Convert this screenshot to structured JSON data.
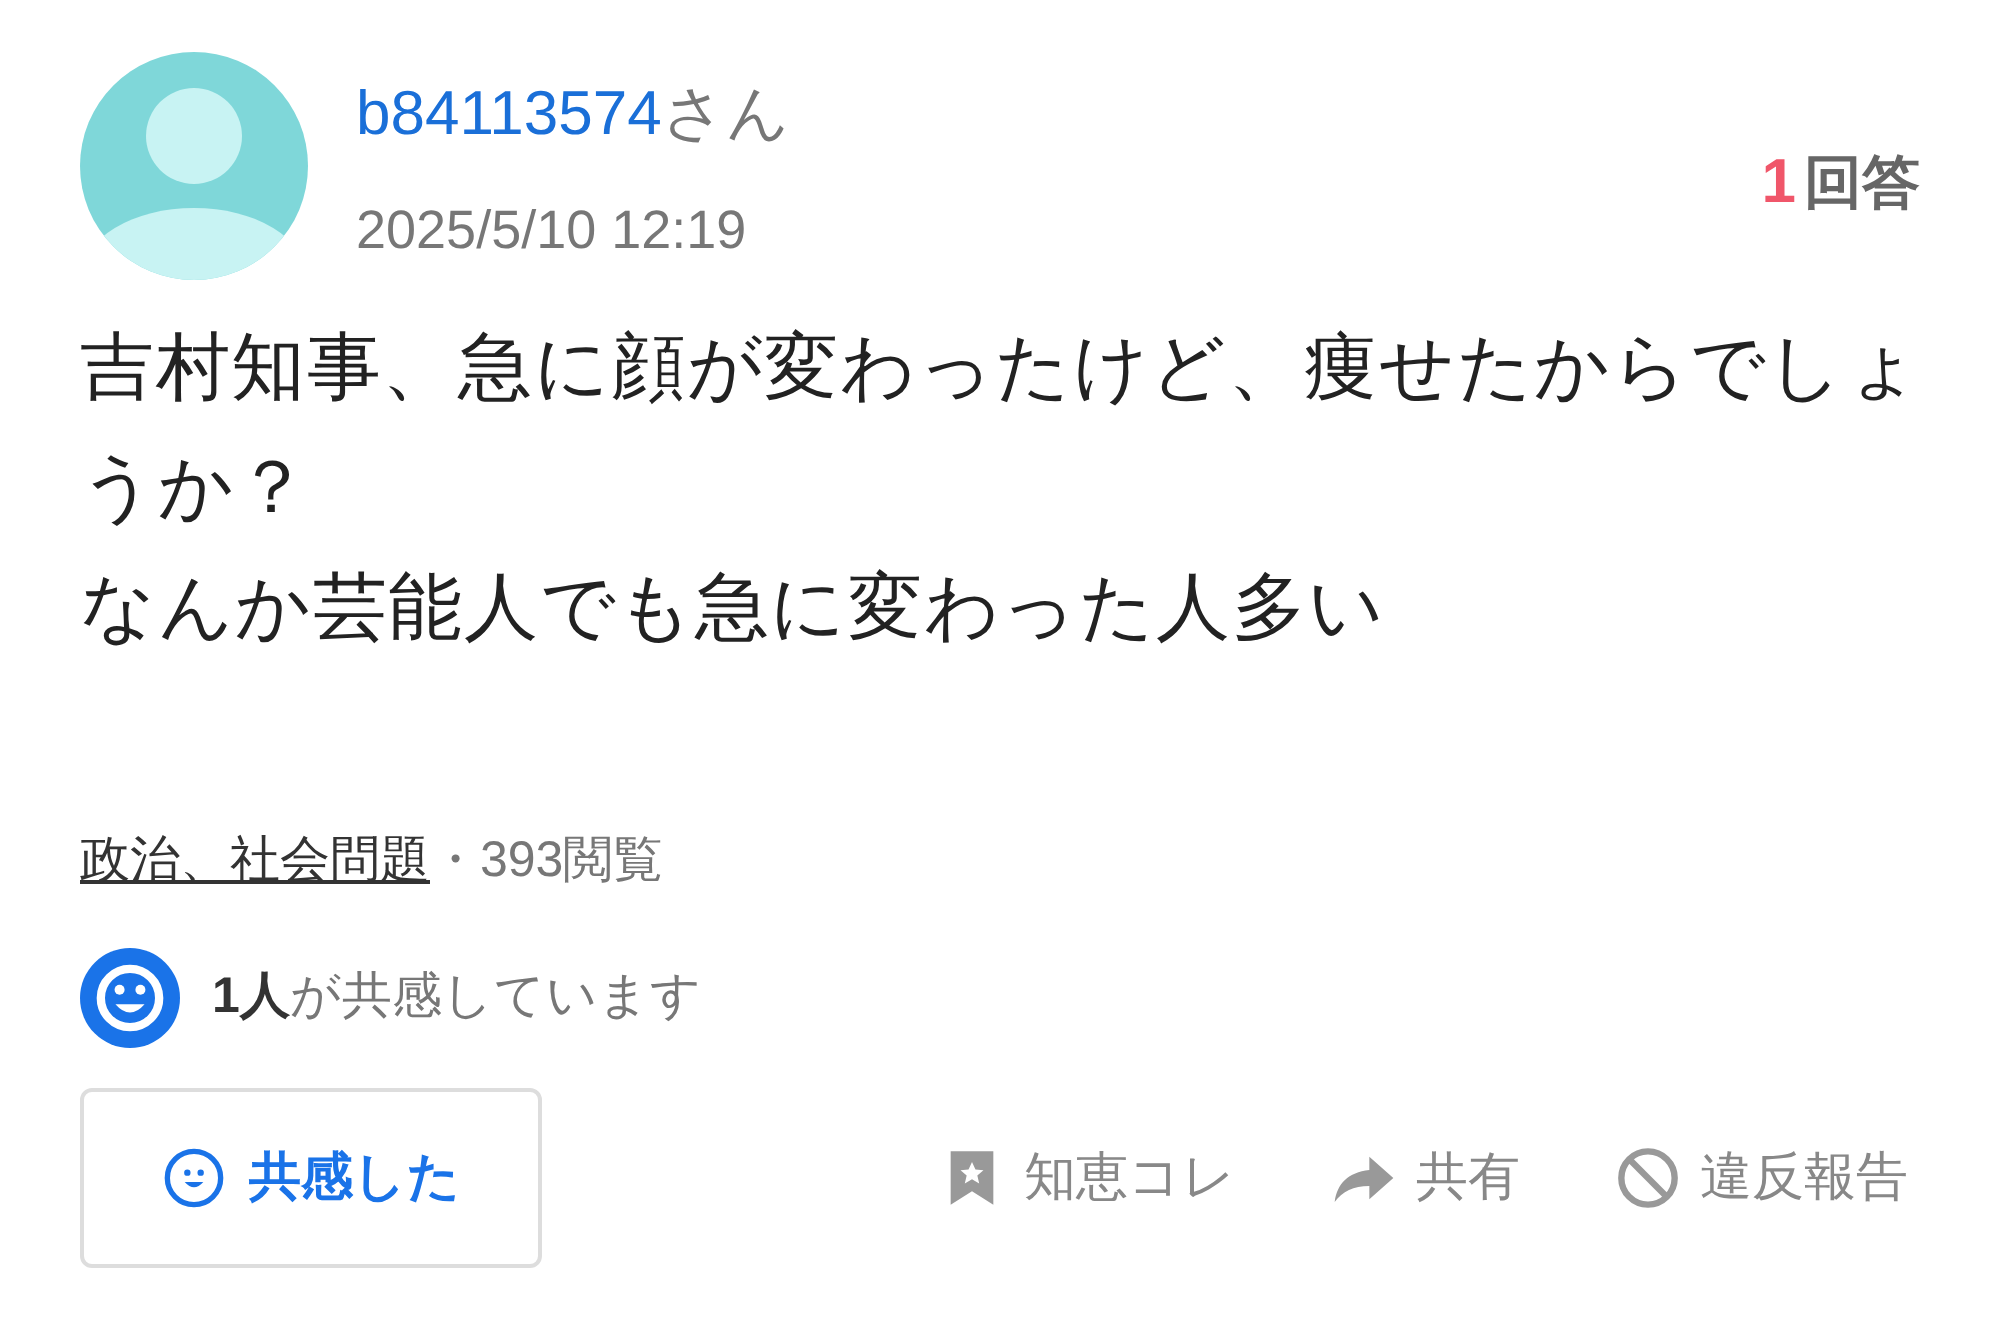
{
  "user": {
    "name": "b84113574",
    "suffix": "さん",
    "date": "2025/5/10 12:19"
  },
  "answers": {
    "count": "1",
    "label": "回答"
  },
  "question": [
    "吉村知事、急に顔が変わったけど、痩せたからでしょうか？",
    "なんか芸能人でも急に変わった人多い"
  ],
  "meta": {
    "category": "政治、社会問題",
    "separator": "・",
    "views": "393閲覧"
  },
  "empathy": {
    "count": "1人",
    "text": "が共感しています"
  },
  "empathy_button": {
    "label": "共感した"
  },
  "actions": [
    {
      "kind": "bookmark",
      "label": "知恵コレ"
    },
    {
      "kind": "share",
      "label": "共有"
    },
    {
      "kind": "report",
      "label": "違反報告"
    }
  ]
}
